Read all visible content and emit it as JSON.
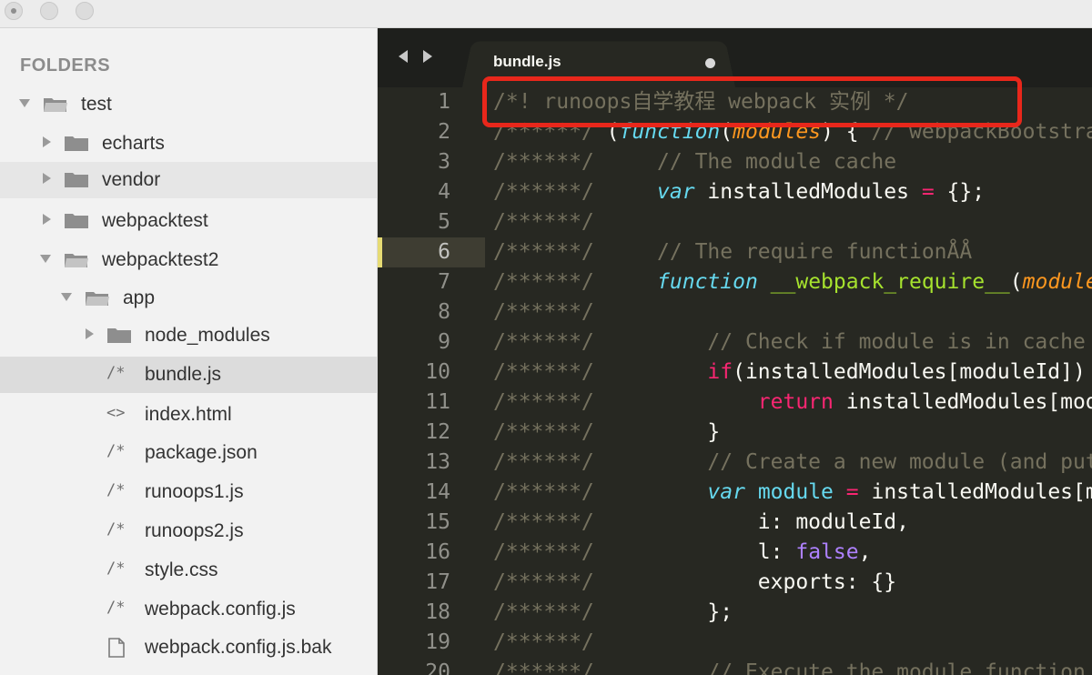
{
  "sidebar": {
    "header": "FOLDERS",
    "items": [
      {
        "label": "test",
        "type": "folder",
        "expanded": true
      },
      {
        "label": "echarts",
        "type": "folder",
        "expanded": false
      },
      {
        "label": "vendor",
        "type": "folder",
        "expanded": false
      },
      {
        "label": "webpacktest",
        "type": "folder",
        "expanded": false
      },
      {
        "label": "webpacktest2",
        "type": "folder",
        "expanded": true
      },
      {
        "label": "app",
        "type": "folder",
        "expanded": true
      },
      {
        "label": "node_modules",
        "type": "folder",
        "expanded": false
      },
      {
        "label": "bundle.js",
        "type": "file",
        "glyph": "/*",
        "selected": true
      },
      {
        "label": "index.html",
        "type": "file",
        "glyph": "<>"
      },
      {
        "label": "package.json",
        "type": "file",
        "glyph": "/*"
      },
      {
        "label": "runoops1.js",
        "type": "file",
        "glyph": "/*"
      },
      {
        "label": "runoops2.js",
        "type": "file",
        "glyph": "/*"
      },
      {
        "label": "style.css",
        "type": "file",
        "glyph": "/*"
      },
      {
        "label": "webpack.config.js",
        "type": "file",
        "glyph": "/*"
      },
      {
        "label": "webpack.config.js.bak",
        "type": "file",
        "glyph": "doc-icon"
      }
    ]
  },
  "editor": {
    "tab": {
      "label": "bundle.js",
      "dirty": true
    },
    "current_line": 6,
    "lines": [
      {
        "n": "1",
        "text": "/*! runoops自学教程 webpack 实例 */"
      },
      {
        "n": "2",
        "text": "/******/ (function(modules) { // webpackBootstrap"
      },
      {
        "n": "3",
        "text": "/******/ \t// The module cache"
      },
      {
        "n": "4",
        "text": "/******/ \tvar installedModules = {};"
      },
      {
        "n": "5",
        "text": "/******/"
      },
      {
        "n": "6",
        "text": "/******/ \t// The require functionÅÅ"
      },
      {
        "n": "7",
        "text": "/******/ \tfunction __webpack_require__(moduleId) {"
      },
      {
        "n": "8",
        "text": "/******/"
      },
      {
        "n": "9",
        "text": "/******/ \t\t// Check if module is in cache"
      },
      {
        "n": "10",
        "text": "/******/ \t\tif(installedModules[moduleId]) {"
      },
      {
        "n": "11",
        "text": "/******/ \t\t\treturn installedModules[moduleId].exports;"
      },
      {
        "n": "12",
        "text": "/******/ \t\t}"
      },
      {
        "n": "13",
        "text": "/******/ \t\t// Create a new module (and put it into the cache)"
      },
      {
        "n": "14",
        "text": "/******/ \t\tvar module = installedModules[moduleId] = {"
      },
      {
        "n": "15",
        "text": "/******/ \t\t\ti: moduleId,"
      },
      {
        "n": "16",
        "text": "/******/ \t\t\tl: false,"
      },
      {
        "n": "17",
        "text": "/******/ \t\t\texports: {}"
      },
      {
        "n": "18",
        "text": "/******/ \t\t};"
      },
      {
        "n": "19",
        "text": "/******/"
      },
      {
        "n": "20",
        "text": "/******/ \t\t// Execute the module function"
      }
    ]
  },
  "colors": {
    "annotation_box": "#e8271b",
    "editor_bg": "#272822",
    "sidebar_bg": "#f2f2f2"
  }
}
